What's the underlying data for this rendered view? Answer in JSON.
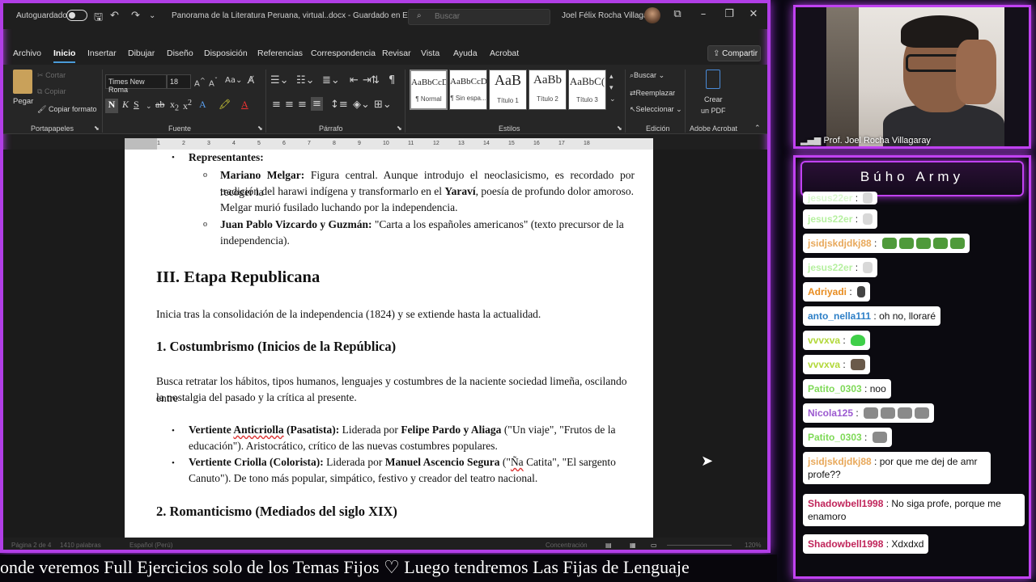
{
  "word": {
    "title_bar": {
      "autosave": "Autoguardado",
      "doc_title": "Panorama de la Literatura Peruana, virtual..docx  -  Guardado en Este PC",
      "search_placeholder": "Buscar",
      "user": "Joel Félix Rocha Villagaray"
    },
    "menu": [
      "Archivo",
      "Inicio",
      "Insertar",
      "Dibujar",
      "Diseño",
      "Disposición",
      "Referencias",
      "Correspondencia",
      "Revisar",
      "Vista",
      "Ayuda",
      "Acrobat"
    ],
    "share": "Compartir",
    "ribbon": {
      "paste": "Pegar",
      "cut": "Cortar",
      "copy": "Copiar",
      "format_painter": "Copiar formato",
      "font_name": "Times New Roma",
      "font_size": "18",
      "styles": [
        {
          "preview": "AaBbCcDc",
          "name": "¶ Normal"
        },
        {
          "preview": "AaBbCcDc",
          "name": "¶ Sin espa..."
        },
        {
          "preview": "AaB",
          "name": "Título 1"
        },
        {
          "preview": "AaBb",
          "name": "Título 2"
        },
        {
          "preview": "AaBbC(",
          "name": "Título 3"
        }
      ],
      "find": "Buscar",
      "replace": "Reemplazar",
      "select": "Seleccionar",
      "create_pdf_1": "Crear",
      "create_pdf_2": "un PDF",
      "groups": {
        "clipboard": "Portapapeles",
        "font": "Fuente",
        "paragraph": "Párrafo",
        "styles": "Estilos",
        "editing": "Edición",
        "acrobat": "Adobe Acrobat"
      }
    },
    "document": {
      "representantes": "Representantes:",
      "melgar_name": "Mariano Melgar:",
      "melgar_l1": " Figura central. Aunque introdujo el neoclasicismo, es recordado por recoger la",
      "melgar_l2a": "tradición del harawi indígena y transformarlo en el ",
      "melgar_l2b": "Yaraví",
      "melgar_l2c": ", poesía de profundo dolor amoroso.",
      "melgar_l3": "Melgar murió fusilado luchando por la independencia.",
      "vizcardo_name": "Juan Pablo Vizcardo y Guzmán:",
      "vizcardo_l1": " \"Carta a los españoles americanos\" (texto precursor de la",
      "vizcardo_l2": "independencia).",
      "h_republicana": "III. Etapa Republicana",
      "republicana_text": "Inicia tras la consolidación de la independencia (1824) y se extiende hasta la actualidad.",
      "h_costumbrismo": "1. Costumbrismo (Inicios de la República)",
      "cost_l1": "Busca retratar los hábitos, tipos humanos, lenguajes y costumbres de la naciente sociedad limeña, oscilando entre",
      "cost_l2": "la nostalgia del pasado y la crítica al presente.",
      "anti_a": "Vertiente ",
      "anti_b": "Anticriolla",
      "anti_c": " (Pasatista):",
      "anti_d": " Liderada por ",
      "anti_e": "Felipe Pardo y Aliaga",
      "anti_f": " (\"Un viaje\", \"Frutos de la",
      "anti_l2": "educación\"). Aristocrático, crítico de las nuevas costumbres populares.",
      "criolla_a": "Vertiente Criolla (Colorista):",
      "criolla_b": " Liderada por ",
      "criolla_c": "Manuel Ascencio Segura",
      "criolla_d": " (\"",
      "criolla_e": "Ña",
      "criolla_f": " Catita\", \"El sargento",
      "criolla_l2": "Canuto\"). De tono más popular, simpático, festivo y creador del teatro nacional.",
      "h_romanticismo": "2. Romanticismo (Mediados del siglo XIX)"
    },
    "status": {
      "page": "Página 2 de 4",
      "words": "1410 palabras",
      "lang": "Español (Perú)",
      "focus": "Concentración",
      "zoom": "120%"
    }
  },
  "ticker": "onde veremos Full Ejercicios solo de los Temas Fijos   ♡   Luego tendremos Las Fijas de Lenguaje",
  "webcam": {
    "name": "Prof. Joel Rocha Villagaray"
  },
  "chat": {
    "title": "Búho Army",
    "messages": [
      {
        "user": "jesus22er",
        "text": "",
        "color": "#b6f0a0"
      },
      {
        "user": "jesus22er",
        "text": "",
        "color": "#b6f0a0"
      },
      {
        "user": "jsidjskdjdkj88",
        "text": "",
        "color": "#e8a85a"
      },
      {
        "user": "jesus22er",
        "text": "",
        "color": "#b6f0a0"
      },
      {
        "user": "Adriyadi",
        "text": "",
        "color": "#e88c1f"
      },
      {
        "user": "anto_nella111",
        "text": "oh no, lloraré",
        "color": "#2d7fc7"
      },
      {
        "user": "vvvxva",
        "text": "",
        "color": "#b2d83a"
      },
      {
        "user": "vvvxva",
        "text": "",
        "color": "#b2d83a"
      },
      {
        "user": "Patito_0303",
        "text": "noo",
        "color": "#7ed957"
      },
      {
        "user": "Nicola125",
        "text": "",
        "color": "#9b59d0"
      },
      {
        "user": "Patito_0303",
        "text": "",
        "color": "#7ed957"
      },
      {
        "user": "jsidjskdjdkj88",
        "text": "por que me dej de amr profe??",
        "color": "#e8a85a"
      },
      {
        "user": "Shadowbell1998",
        "text": "No siga profe, porque me enamoro",
        "color": "#c0245a"
      },
      {
        "user": "Shadowbell1998",
        "text": "Xdxdxd",
        "color": "#c0245a"
      }
    ]
  }
}
